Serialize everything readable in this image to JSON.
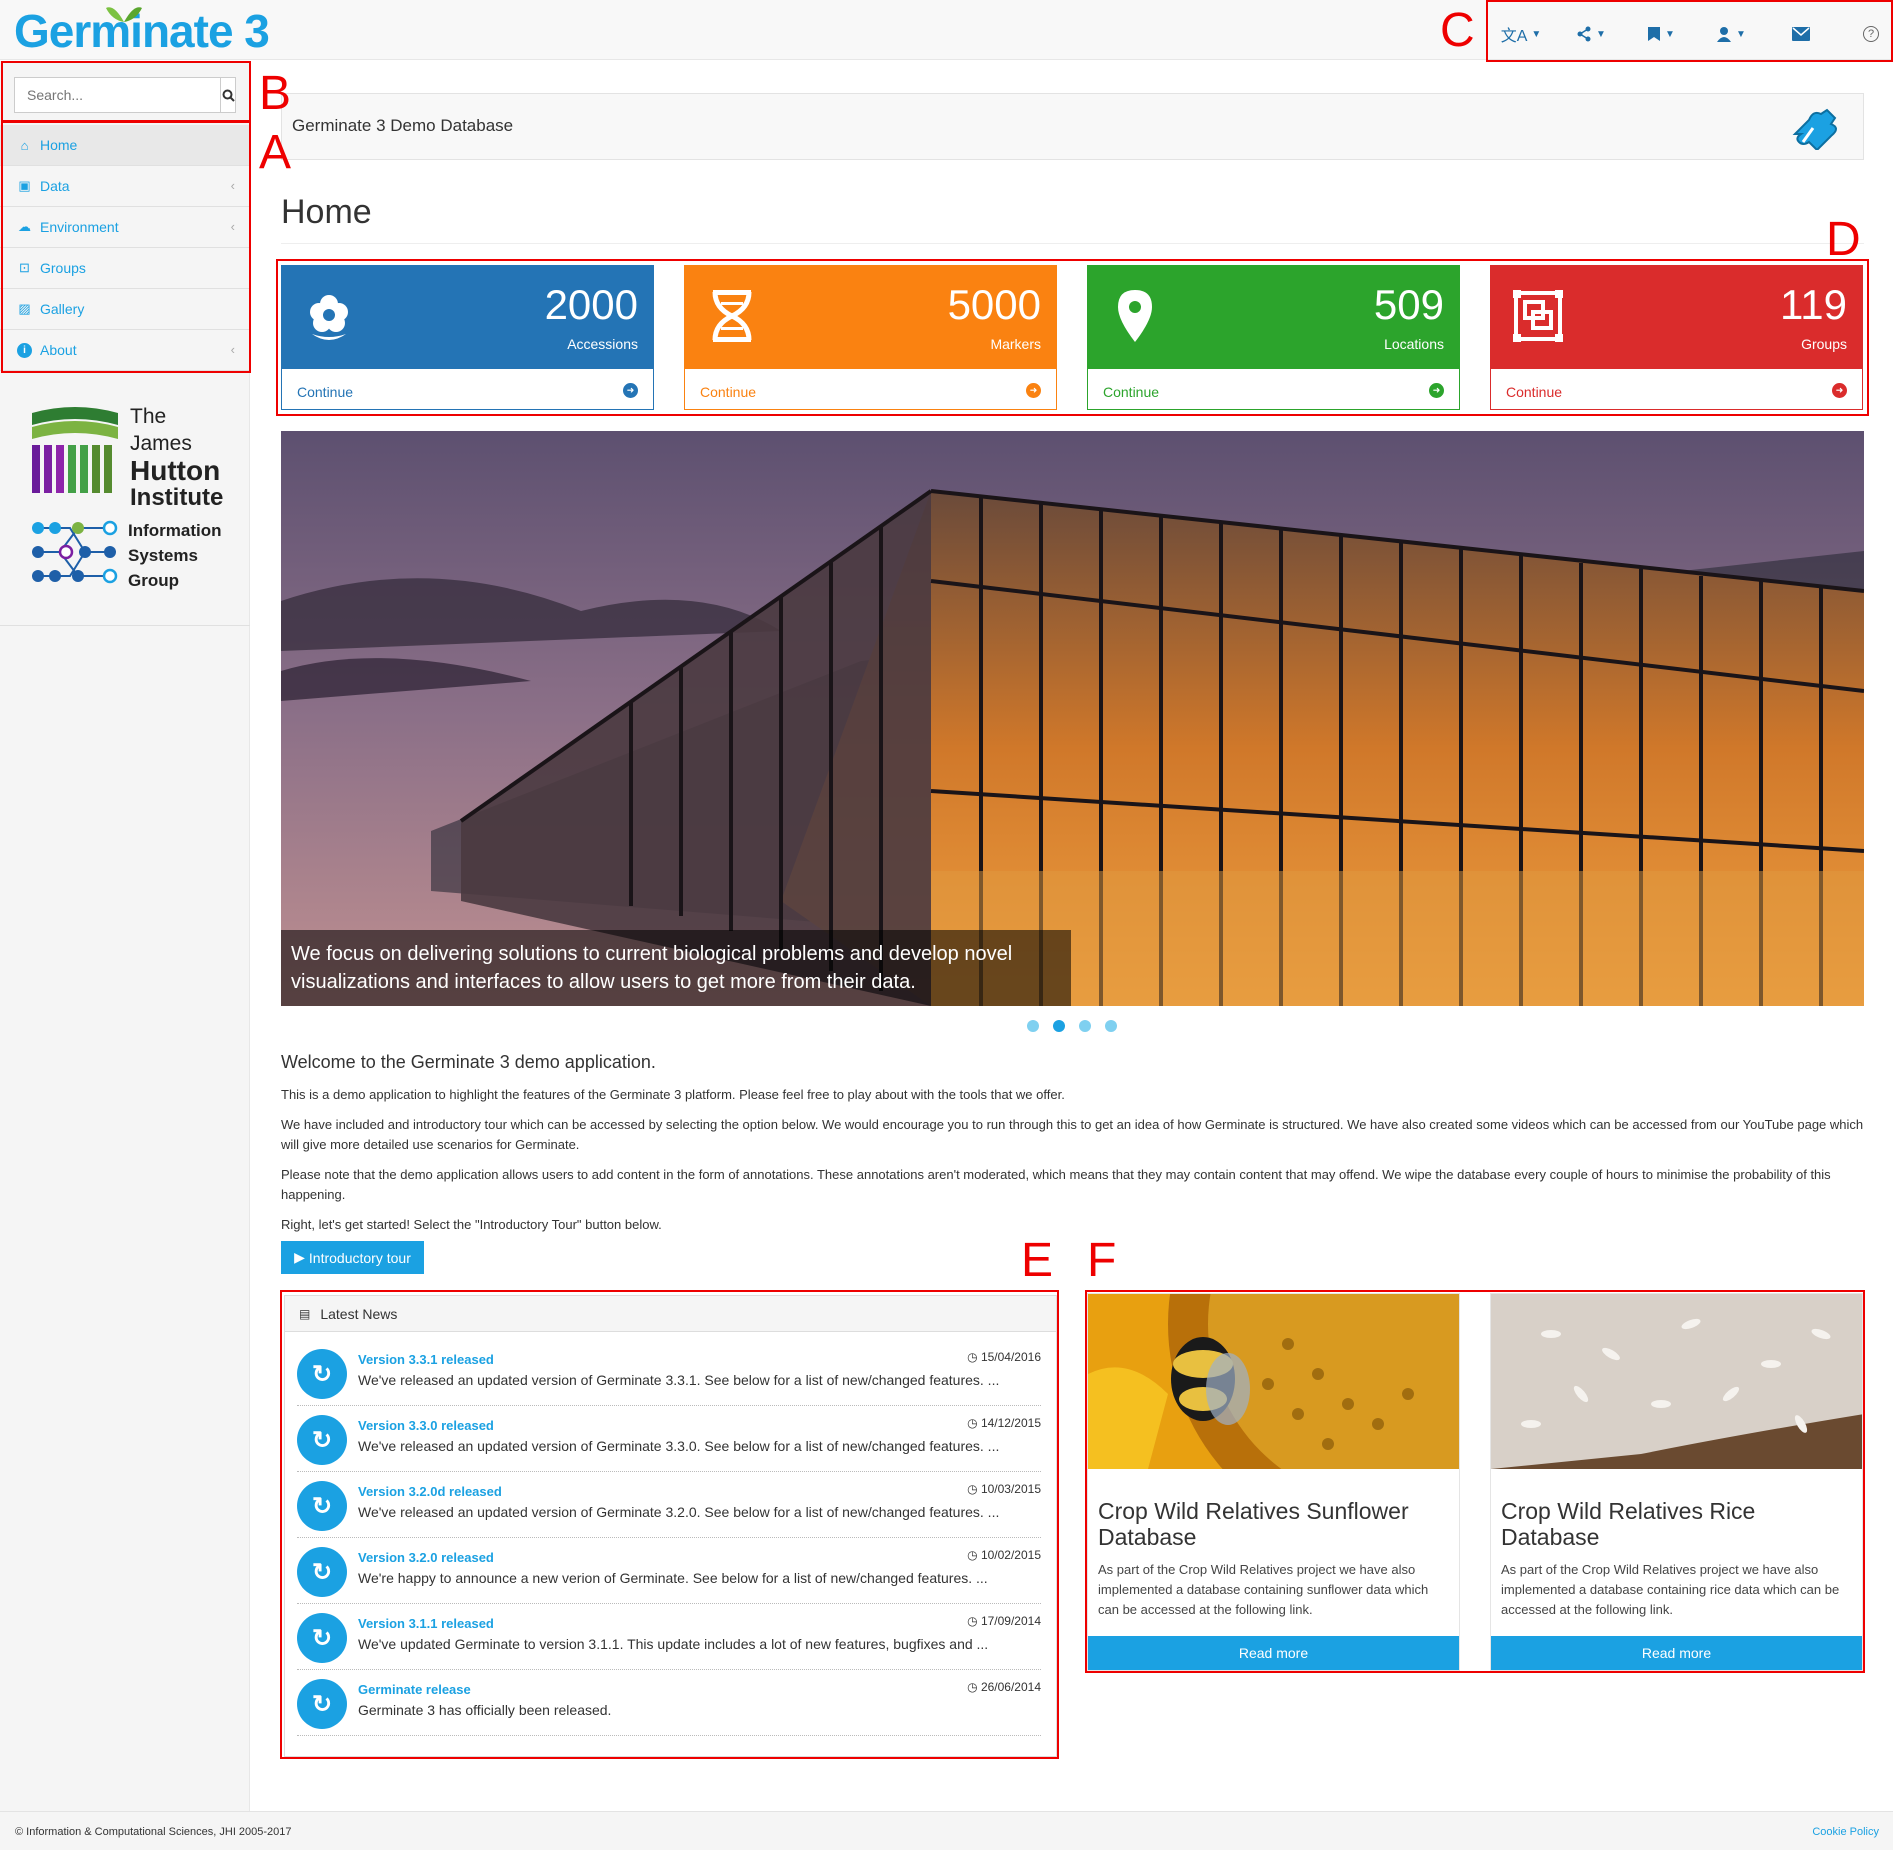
{
  "app": {
    "name": "Germinate 3"
  },
  "colors": {
    "accent": "#1ba1e2",
    "annotation": "#ee0000"
  },
  "topnav": {
    "items": [
      {
        "icon": "translate-icon",
        "dropdown": true
      },
      {
        "icon": "share-icon",
        "dropdown": true
      },
      {
        "icon": "bookmark-icon",
        "dropdown": true
      },
      {
        "icon": "user-icon",
        "dropdown": true
      },
      {
        "icon": "envelope-icon",
        "dropdown": false
      },
      {
        "icon": "help-icon",
        "dropdown": false
      }
    ]
  },
  "search": {
    "placeholder": "Search..."
  },
  "sidebar": {
    "items": [
      {
        "label": "Home",
        "icon": "home-icon",
        "active": true
      },
      {
        "label": "Data",
        "icon": "database-icon",
        "expandable": true
      },
      {
        "label": "Environment",
        "icon": "environment-icon",
        "expandable": true
      },
      {
        "label": "Groups",
        "icon": "groups-icon"
      },
      {
        "label": "Gallery",
        "icon": "gallery-icon"
      },
      {
        "label": "About",
        "icon": "info-icon",
        "expandable": true
      }
    ]
  },
  "logos": {
    "jhi": [
      "The James",
      "Hutton",
      "Institute"
    ],
    "isg": [
      "Information",
      "Systems",
      "Group"
    ]
  },
  "banner": {
    "title": "Germinate 3 Demo Database"
  },
  "page": {
    "title": "Home"
  },
  "stats": [
    {
      "count": "2000",
      "label": "Accessions",
      "link": "Continue",
      "color": "#2474b5",
      "icon": "flower-icon"
    },
    {
      "count": "5000",
      "label": "Markers",
      "link": "Continue",
      "color": "#fa8211",
      "icon": "dna-icon"
    },
    {
      "count": "509",
      "label": "Locations",
      "link": "Continue",
      "color": "#2ca42c",
      "icon": "map-pin-icon"
    },
    {
      "count": "119",
      "label": "Groups",
      "link": "Continue",
      "color": "#da2c2c",
      "icon": "group-icon"
    }
  ],
  "carousel": {
    "caption_line1": "We focus on delivering solutions to current biological problems and develop novel",
    "caption_line2": "visualizations and interfaces to allow users to get more from their data.",
    "active_slide": 2,
    "slide_count": 4
  },
  "welcome": {
    "heading": "Welcome to the Germinate 3 demo application.",
    "p1": "This is a demo application to highlight the features of the Germinate 3 platform. Please feel free to play about with the tools that we offer.",
    "p2": "We have included and introductory tour which can be accessed by selecting the option below. We would encourage you to run through this to get an idea of how Germinate is structured. We have also created some videos which can be accessed from our YouTube page which will give more detailed use scenarios for Germinate.",
    "p3": "Please note that the demo application allows users to add content in the form of annotations. These annotations aren't moderated, which means that they may contain content that may offend. We wipe the database every couple of hours to minimise the probability of this happening.",
    "p4": "Right, let's get started! Select the \"Introductory Tour\" button below.",
    "tour_button": "Introductory tour"
  },
  "news": {
    "title": "Latest News",
    "items": [
      {
        "title": "Version 3.3.1 released",
        "text": "We've released an updated version of Germinate 3.3.1. See below for a list of new/changed features. ...",
        "date": "15/04/2016"
      },
      {
        "title": "Version 3.3.0 released",
        "text": "We've released an updated version of Germinate 3.3.0. See below for a list of new/changed features. ...",
        "date": "14/12/2015"
      },
      {
        "title": "Version 3.2.0d released",
        "text": "We've released an updated version of Germinate 3.2.0. See below for a list of new/changed features. ...",
        "date": "10/03/2015"
      },
      {
        "title": "Version 3.2.0 released",
        "text": "We're happy to announce a new verion of Germinate. See below for a list of new/changed features. ...",
        "date": "10/02/2015"
      },
      {
        "title": "Version 3.1.1 released",
        "text": "We've updated Germinate to version 3.1.1. This update includes a lot of new features, bugfixes and ...",
        "date": "17/09/2014"
      },
      {
        "title": "Germinate release",
        "text": "Germinate 3 has officially been released.",
        "date": "26/06/2014"
      }
    ]
  },
  "projects": [
    {
      "title": "Crop Wild Relatives Sunflower Database",
      "text": "As part of the Crop Wild Relatives project we have also implemented a database containing sunflower data which can be accessed at the following link.",
      "button": "Read more"
    },
    {
      "title": "Crop Wild Relatives Rice Database",
      "text": "As part of the Crop Wild Relatives project we have also implemented a database containing rice data which can be accessed at the following link.",
      "button": "Read more"
    }
  ],
  "annotations": {
    "A": "A",
    "B": "B",
    "C": "C",
    "D": "D",
    "E": "E",
    "F": "F"
  },
  "footer": {
    "copyright": "© Information & Computational Sciences, JHI 2005-2017",
    "cookie": "Cookie Policy"
  }
}
